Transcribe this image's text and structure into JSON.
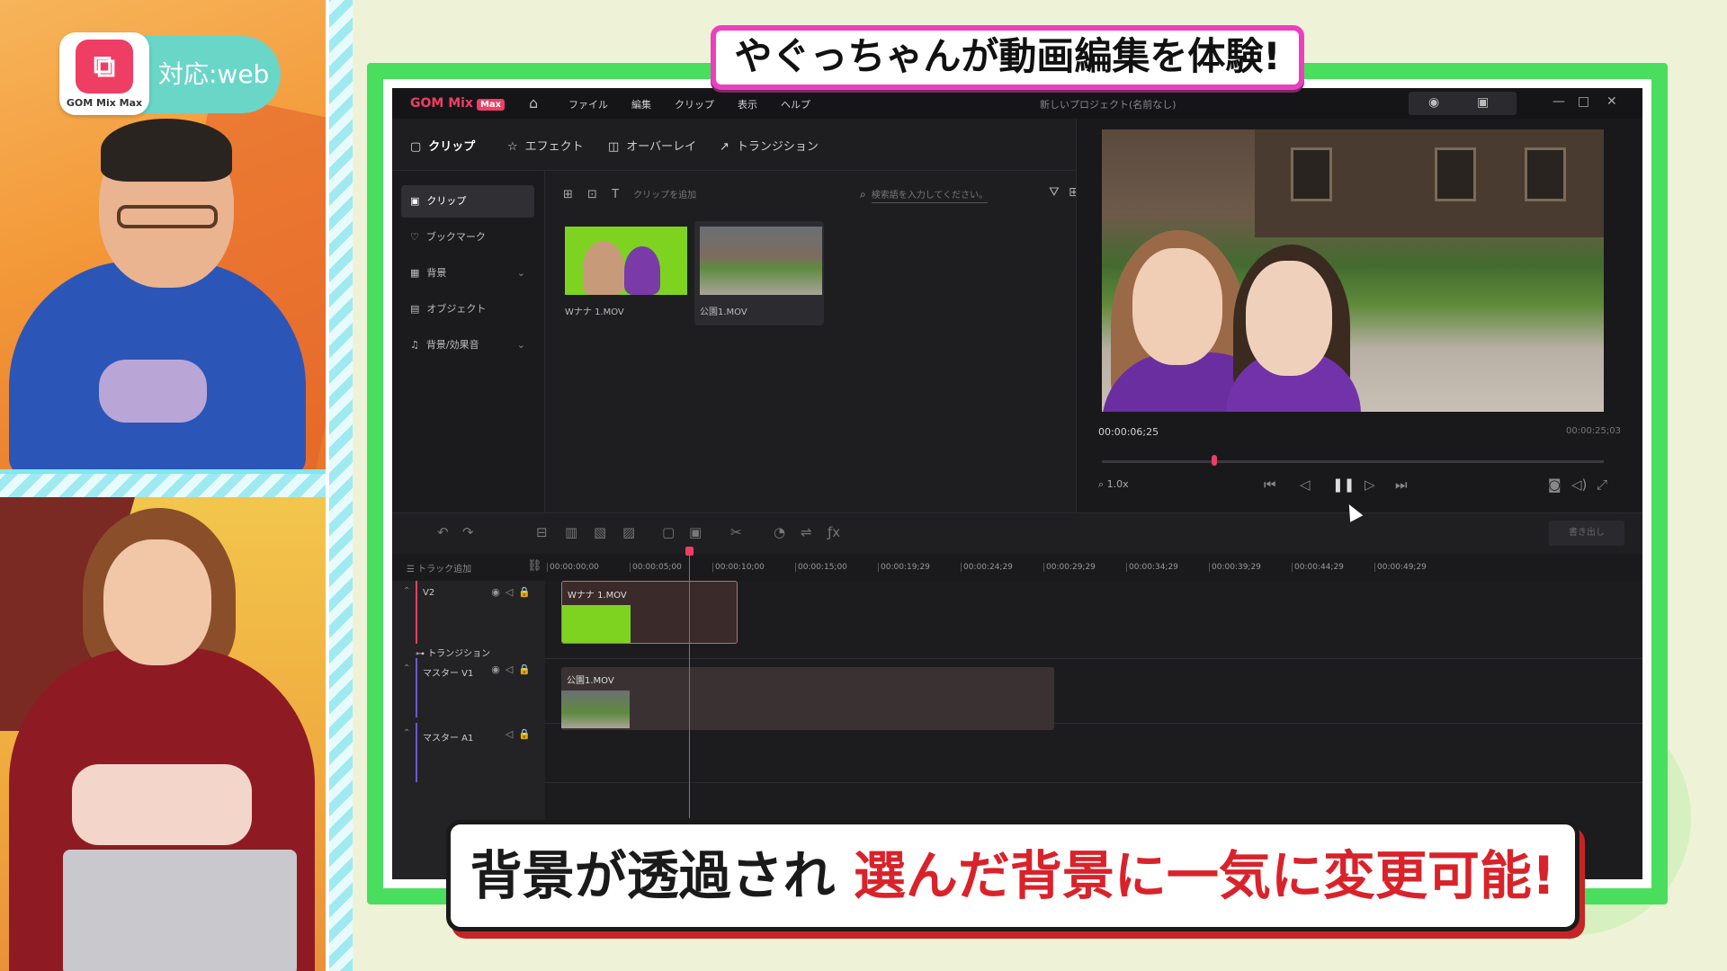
{
  "overlay": {
    "headline": "やぐっちゃんが動画編集を体験!",
    "caption_black": "背景が透過され",
    "caption_red": "選んだ背景に一気に変更可能!",
    "support_label": "対応:web",
    "logo_text": "GOM Mix Max"
  },
  "app": {
    "brand": "GOM Mix",
    "brand_badge": "Max",
    "menu": [
      "ファイル",
      "編集",
      "クリップ",
      "表示",
      "ヘルプ"
    ],
    "project_title": "新しいプロジェクト(名前なし)",
    "tabs": [
      "クリップ",
      "エフェクト",
      "オーバーレイ",
      "トランジション"
    ],
    "sidebar": [
      {
        "label": "クリップ",
        "icon": "folder-icon"
      },
      {
        "label": "ブックマーク",
        "icon": "heart-icon"
      },
      {
        "label": "背景",
        "icon": "pattern-icon"
      },
      {
        "label": "オブジェクト",
        "icon": "object-icon"
      },
      {
        "label": "背景/効果音",
        "icon": "music-icon"
      }
    ],
    "media": {
      "add_label": "クリップを追加",
      "search_placeholder": "検索語を入力してください。",
      "clips": [
        "Wナナ 1.MOV",
        "公園1.MOV"
      ]
    },
    "preview": {
      "current_time": "00:00:06;25",
      "total_time": "00:00:25;03",
      "zoom": "1.0x",
      "progress": 0.224
    },
    "toolbar": {
      "export_label": "書き出し"
    },
    "timeline": {
      "add_track_label": "トラック追加",
      "ruler": [
        "00:00:00;00",
        "00:00:05;00",
        "00:00:10;00",
        "00:00:15;00",
        "00:00:19;29",
        "00:00:24;29",
        "00:00:29;29",
        "00:00:34;29",
        "00:00:39;29",
        "00:00:44;29",
        "00:00:49;29"
      ],
      "tracks": [
        {
          "name": "V2",
          "clip": "Wナナ 1.MOV"
        },
        {
          "name": "マスター V1",
          "clip": "公園1.MOV"
        },
        {
          "name": "マスター A1",
          "clip": ""
        }
      ],
      "transition_label": "トランジション"
    }
  },
  "colors": {
    "brand": "#ef3e64",
    "frame_green": "#49de5e",
    "title_border": "#ec3fbd",
    "caption_red": "#d9222a"
  }
}
